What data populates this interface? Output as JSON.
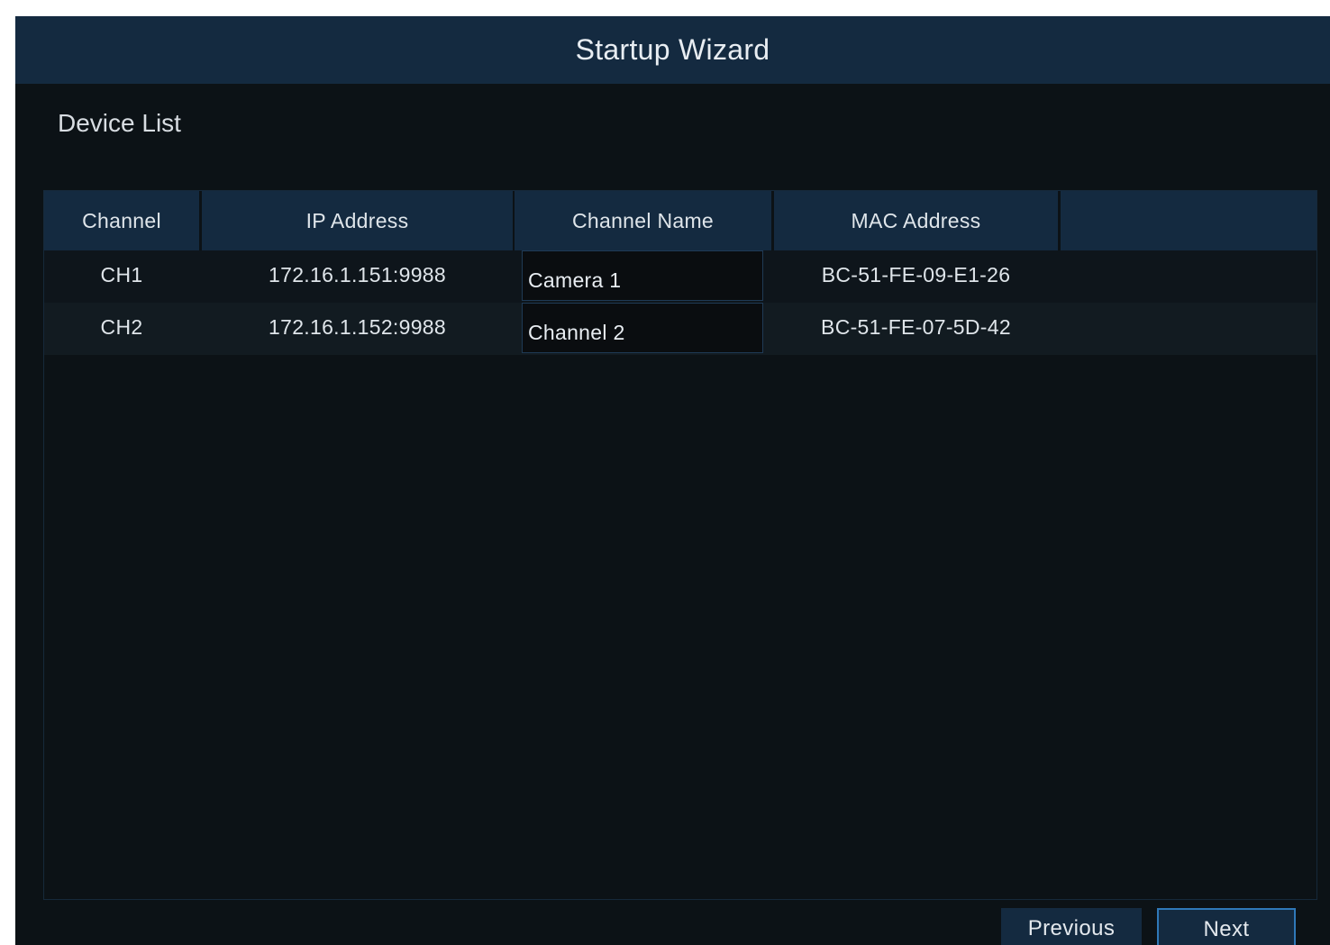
{
  "window": {
    "title": "Startup Wizard"
  },
  "section": {
    "title": "Device List"
  },
  "table": {
    "headers": [
      "Channel",
      "IP Address",
      "Channel Name",
      "MAC Address",
      ""
    ],
    "rows": [
      {
        "channel": "CH1",
        "ip": "172.16.1.151:9988",
        "name": "Camera 1",
        "mac": "BC-51-FE-09-E1-26"
      },
      {
        "channel": "CH2",
        "ip": "172.16.1.152:9988",
        "name": "Channel 2",
        "mac": "BC-51-FE-07-5D-42"
      }
    ]
  },
  "buttons": {
    "previous": "Previous",
    "next": "Next"
  },
  "colors": {
    "accent": "#2f78b8",
    "header_bg": "#142a40",
    "window_bg": "#0c1216"
  }
}
